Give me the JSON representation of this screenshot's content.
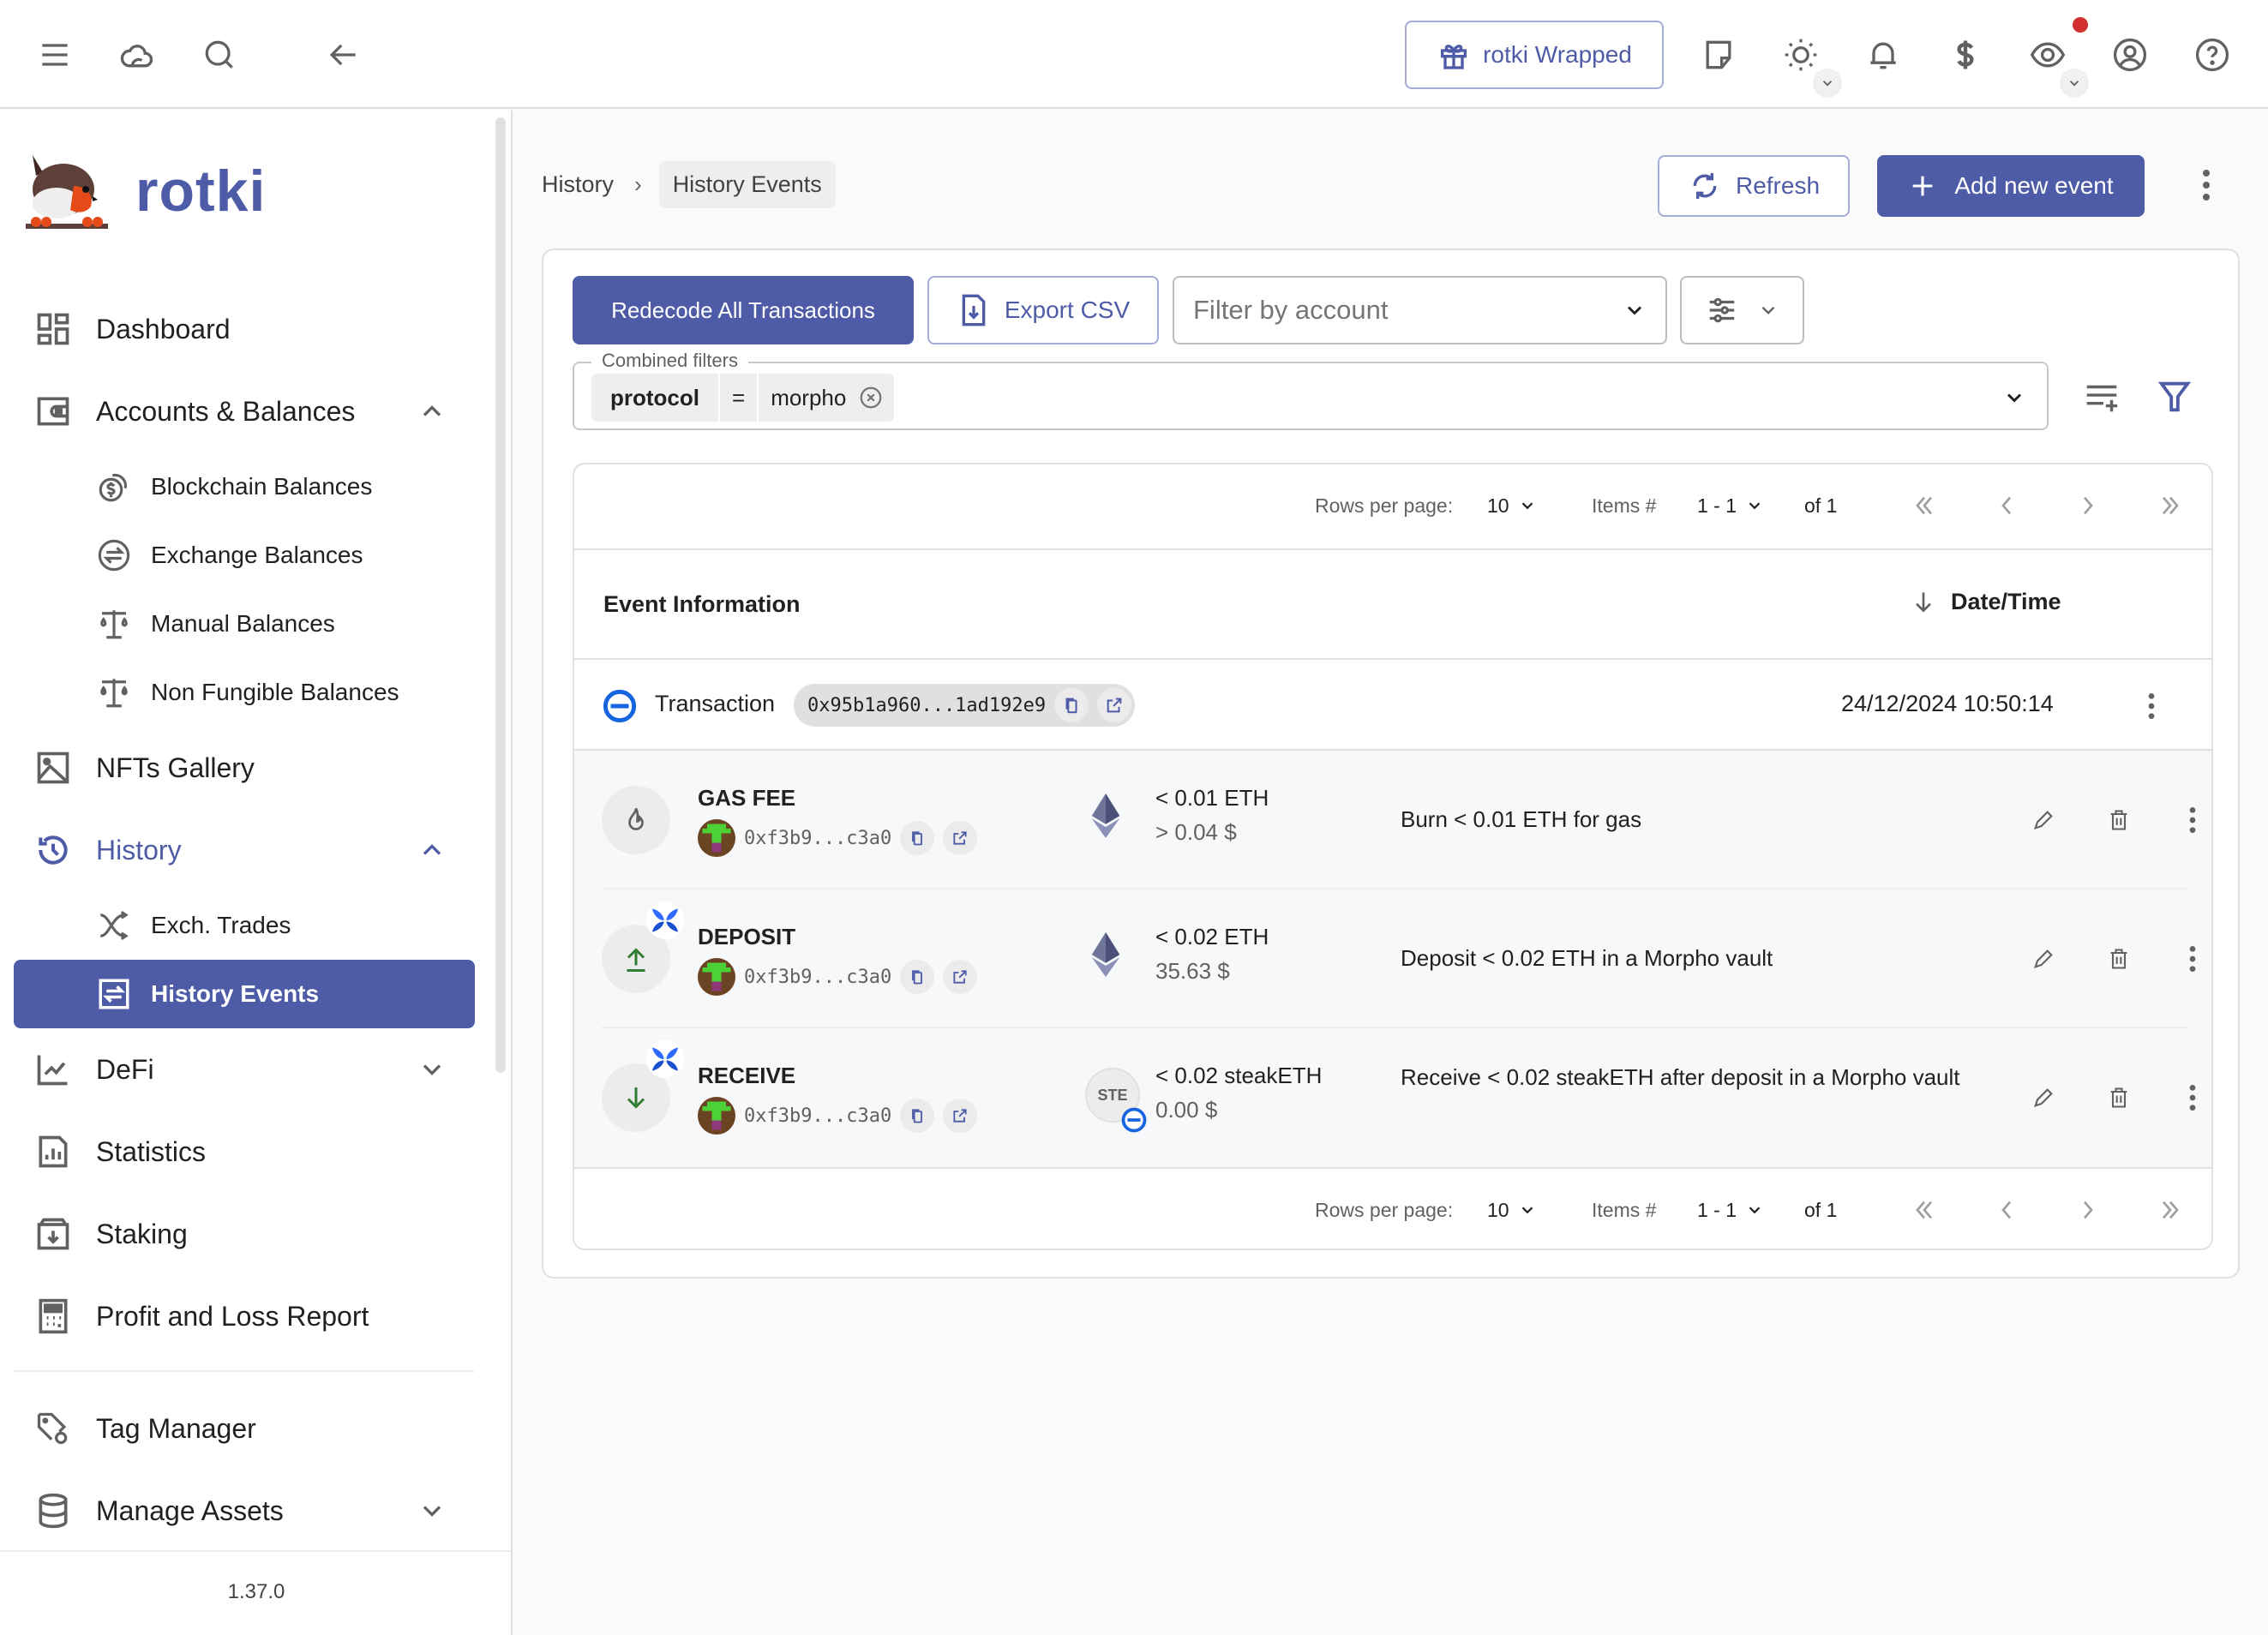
{
  "topbar": {
    "wrapped_label": "rotki Wrapped",
    "icons": [
      "menu-icon",
      "cloud-icon",
      "search-icon",
      "back-arrow-icon",
      "gift-icon",
      "note-icon",
      "theme-sun-icon",
      "bell-icon",
      "currency-dollar-icon",
      "privacy-eye-icon",
      "account-icon",
      "help-icon"
    ],
    "notification_dot_color": "#d32f2f"
  },
  "sidebar": {
    "brand": "rotki",
    "version": "1.37.0",
    "items": [
      {
        "label": "Dashboard",
        "icon": "dashboard-icon"
      },
      {
        "label": "Accounts & Balances",
        "icon": "wallet-icon",
        "expanded": true,
        "children": [
          {
            "label": "Blockchain Balances",
            "icon": "coins-icon"
          },
          {
            "label": "Exchange Balances",
            "icon": "exchange-icon"
          },
          {
            "label": "Manual Balances",
            "icon": "scale-icon"
          },
          {
            "label": "Non Fungible Balances",
            "icon": "scale-icon"
          }
        ]
      },
      {
        "label": "NFTs Gallery",
        "icon": "image-icon"
      },
      {
        "label": "History",
        "icon": "history-icon",
        "expanded": true,
        "active": true,
        "children": [
          {
            "label": "Exch. Trades",
            "icon": "shuffle-icon"
          },
          {
            "label": "History Events",
            "icon": "swap-box-icon",
            "selected": true
          }
        ]
      },
      {
        "label": "DeFi",
        "icon": "chart-line-icon",
        "expanded": false
      },
      {
        "label": "Statistics",
        "icon": "stats-icon"
      },
      {
        "label": "Staking",
        "icon": "staking-icon"
      },
      {
        "label": "Profit and Loss Report",
        "icon": "calculator-icon"
      },
      {
        "label": "Tag Manager",
        "icon": "tag-gear-icon"
      },
      {
        "label": "Manage Assets",
        "icon": "database-icon",
        "expanded": false
      }
    ]
  },
  "breadcrumb": {
    "parent": "History",
    "current": "History Events"
  },
  "header_actions": {
    "refresh": "Refresh",
    "add_event": "Add new event"
  },
  "toolbar": {
    "redecode": "Redecode All Transactions",
    "export": "Export CSV",
    "account_filter_placeholder": "Filter by account",
    "combined_filters_label": "Combined filters",
    "filter_chip": {
      "key": "protocol",
      "op": "=",
      "value": "morpho"
    }
  },
  "pagination": {
    "rows_per_page_label": "Rows per page:",
    "rows_per_page": "10",
    "items_label": "Items #",
    "items_range": "1 - 1",
    "of_label": "of 1"
  },
  "table": {
    "col_event_info": "Event Information",
    "col_datetime": "Date/Time",
    "transaction": {
      "label": "Transaction",
      "hash": "0x95b1a960...1ad192e9",
      "datetime": "24/12/2024 10:50:14"
    },
    "events": [
      {
        "type": "GAS FEE",
        "address": "0xf3b9...c3a0",
        "amount": "< 0.01 ETH",
        "value": "> 0.04 $",
        "asset": "ETH",
        "description": "Burn < 0.01 ETH for gas",
        "icon": "flame-icon"
      },
      {
        "type": "DEPOSIT",
        "address": "0xf3b9...c3a0",
        "amount": "< 0.02 ETH",
        "value": "35.63 $",
        "asset": "ETH",
        "description": "Deposit < 0.02 ETH in a Morpho vault",
        "icon": "upload-arrow-icon",
        "protocol": "morpho"
      },
      {
        "type": "RECEIVE",
        "address": "0xf3b9...c3a0",
        "amount": "< 0.02 steakETH",
        "value": "0.00 $",
        "asset": "STE",
        "description": "Receive < 0.02 steakETH after deposit in a Morpho vault",
        "icon": "download-arrow-icon",
        "protocol": "morpho"
      }
    ]
  },
  "colors": {
    "primary": "#4e5ba6",
    "deposit_green": "#2e7d32",
    "morpho_blue": "#1565e0"
  }
}
